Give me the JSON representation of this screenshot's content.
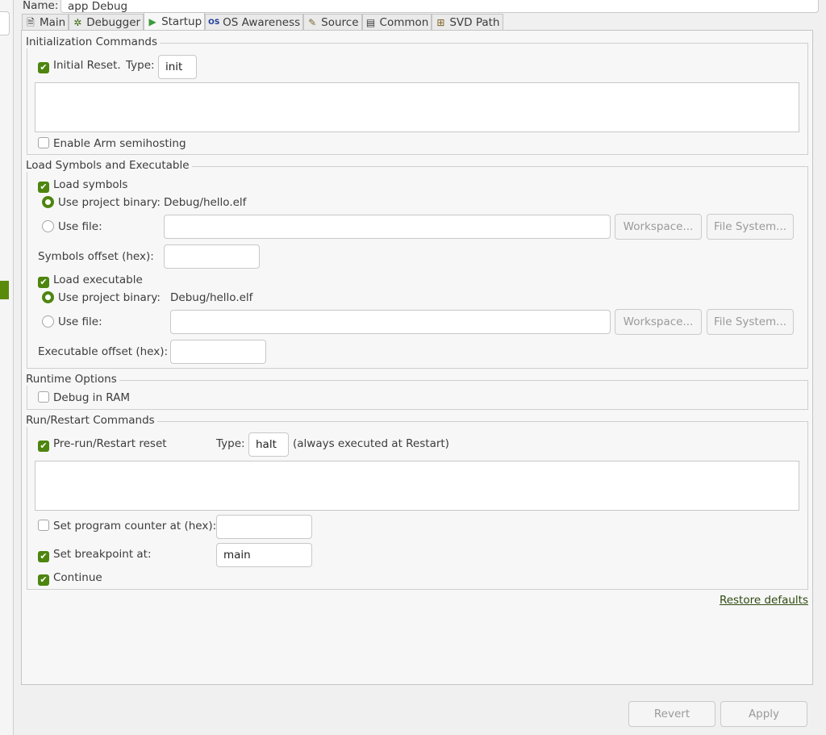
{
  "name_field": {
    "label": "Name:",
    "value": "app Debug"
  },
  "tabs": [
    {
      "label": "Main",
      "icon": "document-icon"
    },
    {
      "label": "Debugger",
      "icon": "bug-icon"
    },
    {
      "label": "Startup",
      "icon": "play-icon",
      "active": true
    },
    {
      "label": "OS Awareness",
      "icon": "os-icon"
    },
    {
      "label": "Source",
      "icon": "source-icon"
    },
    {
      "label": "Common",
      "icon": "table-icon"
    },
    {
      "label": "SVD Path",
      "icon": "tree-icon"
    }
  ],
  "init": {
    "title": "Initialization Commands",
    "initial_reset": "Initial Reset.",
    "initial_reset_checked": true,
    "type_label": "Type:",
    "type_value": "init",
    "commands": "",
    "semihosting": "Enable Arm semihosting",
    "semihosting_checked": false
  },
  "load": {
    "title": "Load Symbols and Executable",
    "load_symbols": "Load symbols",
    "load_symbols_checked": true,
    "sym_project": "Use project binary:",
    "sym_project_value": "Debug/hello.elf",
    "sym_file": "Use file:",
    "sym_file_value": "",
    "workspace": "Workspace...",
    "filesystem": "File System...",
    "sym_offset": "Symbols offset (hex):",
    "sym_offset_value": "",
    "load_exec": "Load executable",
    "load_exec_checked": true,
    "exe_project": "Use project binary:",
    "exe_project_value": "Debug/hello.elf",
    "exe_file": "Use file:",
    "exe_file_value": "",
    "exe_offset": "Executable offset (hex):",
    "exe_offset_value": ""
  },
  "runtime": {
    "title": "Runtime Options",
    "debug_ram": "Debug in RAM",
    "debug_ram_checked": false
  },
  "run": {
    "title": "Run/Restart Commands",
    "prerun": "Pre-run/Restart reset",
    "prerun_checked": true,
    "type_label": "Type:",
    "type_value": "halt",
    "note": "(always executed at Restart)",
    "commands": "",
    "set_pc": "Set program counter at (hex):",
    "set_pc_checked": false,
    "set_pc_value": "",
    "set_bp": "Set breakpoint at:",
    "set_bp_checked": true,
    "set_bp_value": "main",
    "cont": "Continue",
    "cont_checked": true
  },
  "restore": "Restore defaults",
  "revert": "Revert",
  "apply": "Apply",
  "accent": "#4e850f"
}
